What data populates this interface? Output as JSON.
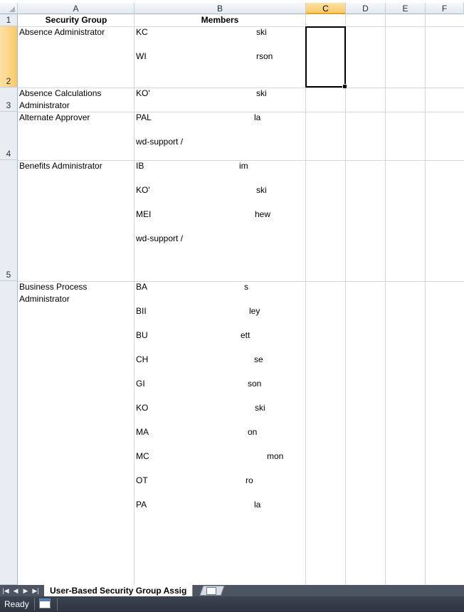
{
  "columns": [
    "A",
    "B",
    "C",
    "D",
    "E",
    "F"
  ],
  "rows": [
    "1",
    "2",
    "3",
    "4",
    "5"
  ],
  "header_row": {
    "security_group": "Security Group",
    "members": "Members"
  },
  "groups": [
    {
      "row": "2",
      "name_lines": [
        "Absence Administrator"
      ],
      "members": [
        {
          "pre": "KC",
          "suf": "ski"
        },
        {
          "pre": "WI",
          "suf": "rson"
        }
      ]
    },
    {
      "row": "3",
      "name_lines": [
        "Absence Calculations",
        "Administrator"
      ],
      "members": [
        {
          "pre": "KO'",
          "suf": "ski"
        }
      ]
    },
    {
      "row": "4",
      "name_lines": [
        "Alternate Approver"
      ],
      "members": [
        {
          "pre": "PAL",
          "suf": "la"
        },
        {
          "pre": "wd-support /",
          "suf": ""
        }
      ]
    },
    {
      "row": "5",
      "name_lines": [
        "Benefits Administrator"
      ],
      "members": [
        {
          "pre": "IB",
          "suf": "im"
        },
        {
          "pre": "KO'",
          "suf": "ski"
        },
        {
          "pre": "MEI",
          "suf": "hew"
        },
        {
          "pre": "wd-support /",
          "suf": ""
        }
      ]
    },
    {
      "row": "",
      "name_lines": [
        "Business Process",
        "Administrator"
      ],
      "members": [
        {
          "pre": "BA",
          "suf": "s"
        },
        {
          "pre": "BII",
          "suf": "ley"
        },
        {
          "pre": "BU",
          "suf": "ett"
        },
        {
          "pre": "CH",
          "suf": "se"
        },
        {
          "pre": "GI",
          "suf": "son"
        },
        {
          "pre": "KO",
          "suf": "ski"
        },
        {
          "pre": "MA",
          "suf": "on"
        },
        {
          "pre": "MC",
          "suf": "mon"
        },
        {
          "pre": "OT",
          "suf": "ro"
        },
        {
          "pre": "PA",
          "suf": "la"
        }
      ]
    }
  ],
  "sheet_tab": {
    "label": "User-Based Security Group Assig"
  },
  "status": {
    "ready": "Ready"
  },
  "selected_cell": "C2"
}
